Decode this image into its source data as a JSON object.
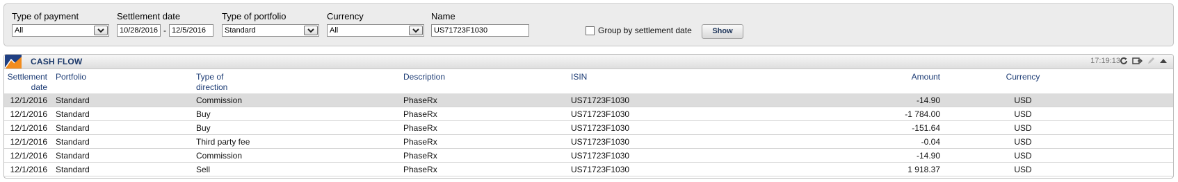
{
  "filters": {
    "payment_type": {
      "label": "Type of payment",
      "value": "All"
    },
    "settlement_date": {
      "label": "Settlement date",
      "from": "10/28/2016",
      "separator": "-",
      "to": "12/5/2016"
    },
    "portfolio_type": {
      "label": "Type of portfolio",
      "value": "Standard"
    },
    "currency": {
      "label": "Currency",
      "value": "All"
    },
    "name": {
      "label": "Name",
      "value": "US71723F1030"
    },
    "group_by_settlement": {
      "label": "Group by settlement date",
      "checked": false
    },
    "show_button": "Show"
  },
  "panel": {
    "title": "CASH FLOW",
    "time": "17:19:13",
    "icons": [
      "refresh-icon",
      "export-icon",
      "edit-icon",
      "collapse-icon"
    ]
  },
  "table": {
    "headers": {
      "settlement_date": [
        "Settlement",
        "date"
      ],
      "portfolio": "Portfolio",
      "direction": [
        "Type of",
        "direction"
      ],
      "description": "Description",
      "isin": "ISIN",
      "amount": "Amount",
      "currency": "Currency"
    },
    "rows": [
      {
        "date": "12/1/2016",
        "portfolio": "Standard",
        "direction": "Commission",
        "description": "PhaseRx",
        "isin": "US71723F1030",
        "amount": "-14.90",
        "currency": "USD"
      },
      {
        "date": "12/1/2016",
        "portfolio": "Standard",
        "direction": "Buy",
        "description": "PhaseRx",
        "isin": "US71723F1030",
        "amount": "-1 784.00",
        "currency": "USD"
      },
      {
        "date": "12/1/2016",
        "portfolio": "Standard",
        "direction": "Buy",
        "description": "PhaseRx",
        "isin": "US71723F1030",
        "amount": "-151.64",
        "currency": "USD"
      },
      {
        "date": "12/1/2016",
        "portfolio": "Standard",
        "direction": "Third party fee",
        "description": "PhaseRx",
        "isin": "US71723F1030",
        "amount": "-0.04",
        "currency": "USD"
      },
      {
        "date": "12/1/2016",
        "portfolio": "Standard",
        "direction": "Commission",
        "description": "PhaseRx",
        "isin": "US71723F1030",
        "amount": "-14.90",
        "currency": "USD"
      },
      {
        "date": "12/1/2016",
        "portfolio": "Standard",
        "direction": "Sell",
        "description": "PhaseRx",
        "isin": "US71723F1030",
        "amount": "1 918.37",
        "currency": "USD"
      }
    ]
  }
}
